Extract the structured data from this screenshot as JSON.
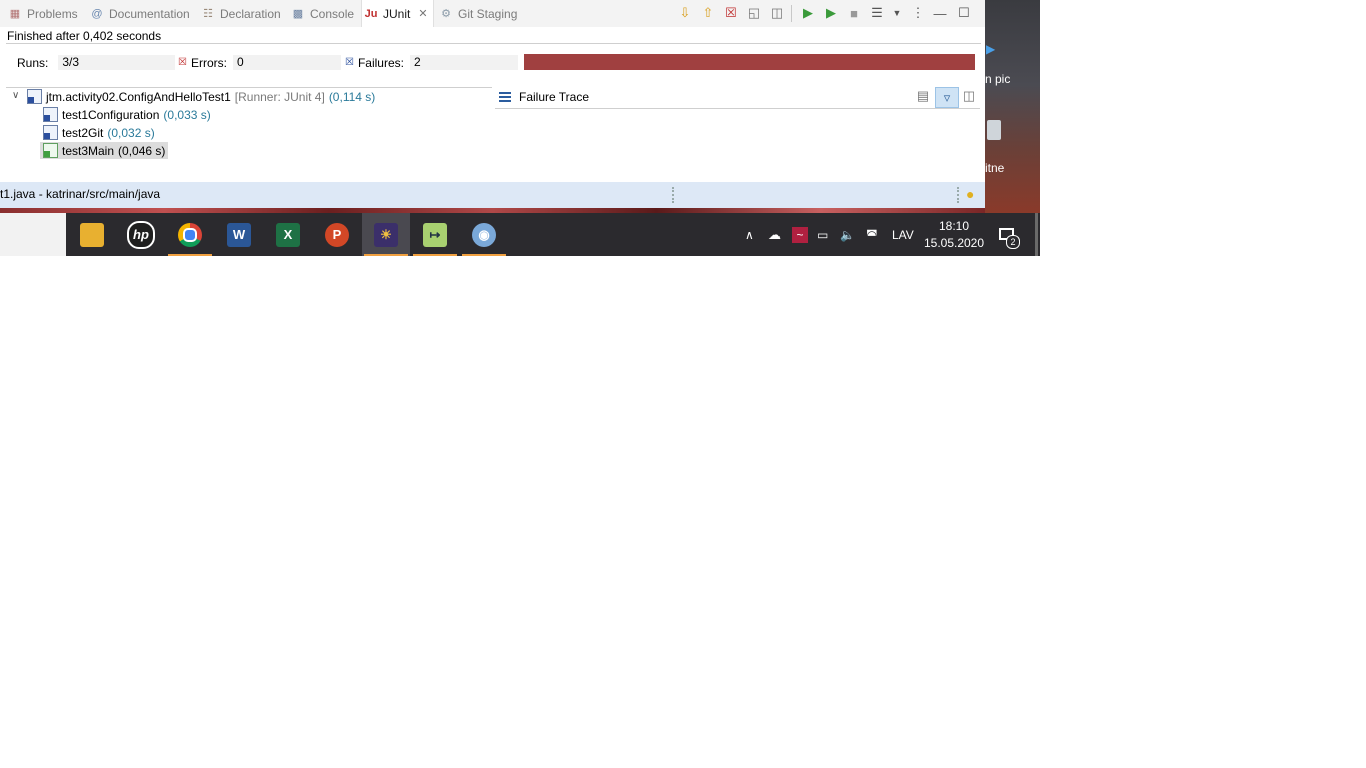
{
  "tabs": [
    {
      "label": "Problems",
      "icon": "problems-icon"
    },
    {
      "label": "Documentation",
      "icon": "at-icon"
    },
    {
      "label": "Declaration",
      "icon": "declaration-icon"
    },
    {
      "label": "Console",
      "icon": "console-icon"
    },
    {
      "label": "JUnit",
      "icon": "junit-icon",
      "active": true
    },
    {
      "label": "Git Staging",
      "icon": "git-staging-icon"
    }
  ],
  "junit": {
    "status": "Finished after 0,402 seconds",
    "runs_label": "Runs:",
    "runs_value": "3/3",
    "errors_label": "Errors:",
    "errors_value": "0",
    "failures_label": "Failures:",
    "failures_value": "2",
    "progress_color": "#a04040",
    "progress_fraction": 1.0
  },
  "tree": {
    "root": {
      "label": "jtm.activity02.ConfigAndHelloTest1",
      "runner": "[Runner: JUnit 4]",
      "time": "(0,114 s)"
    },
    "children": [
      {
        "label": "test1Configuration",
        "time": "(0,033 s)",
        "status": "failure"
      },
      {
        "label": "test2Git",
        "time": "(0,032 s)",
        "status": "failure"
      },
      {
        "label": "test3Main",
        "time": "(0,046 s)",
        "status": "success",
        "selected": true
      }
    ]
  },
  "trace": {
    "title": "Failure Trace"
  },
  "footer": {
    "path": "t1.java - katrinar/src/main/java"
  },
  "desktop": {
    "label1": "n pic",
    "label2": "itne"
  },
  "taskbar": {
    "apps": [
      "file-explorer-icon",
      "hp-icon",
      "chrome-icon",
      "word-icon",
      "excel-icon",
      "powerpoint-icon",
      "eclipse-icon",
      "notepad-icon",
      "paint-icon"
    ],
    "language": "LAV",
    "time": "18:10",
    "date": "15.05.2020",
    "notifications": "2"
  }
}
